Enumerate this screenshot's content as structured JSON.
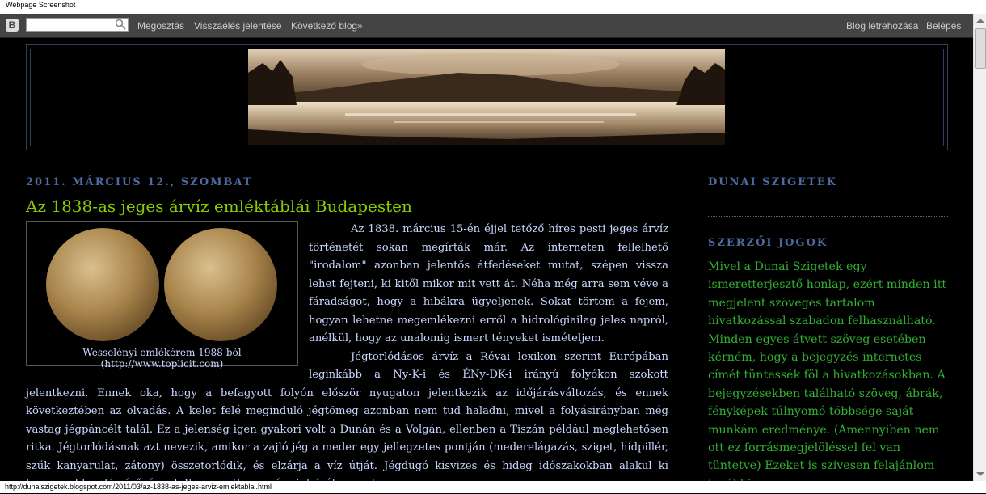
{
  "screenshot_label": "Webpage Screenshot",
  "navbar": {
    "search_placeholder": "",
    "links_left": [
      "Megosztás",
      "Visszaélés jelentése",
      "Következő blog»"
    ],
    "links_right": [
      "Blog létrehozása",
      "Belépés"
    ]
  },
  "post": {
    "date": "2011. március 12., szombat",
    "title": "Az 1838-as jeges árvíz emléktáblái Budapesten",
    "image_caption": "Wesselényi emlékérem 1988-ból (http://www.toplicit.com)",
    "paragraphs": [
      "Az 1838. március 15-én éjjel tetőző híres pesti jeges árvíz történetét sokan megírták már. Az interneten fellelhető \"irodalom\" azonban jelentős átfedéseket mutat, szépen vissza lehet fejteni, ki kitől mikor mit vett át. Néha még arra sem véve a fáradságot, hogy a hibákra ügyeljenek. Sokat törtem a fejem, hogyan lehetne megemlékezni erről a hidrológiailag jeles napról, anélkül, hogy az unalomig ismert tényeket ismételjem.",
      "Jégtorlódásos árvíz a Révai lexikon szerint Európában leginkább a Ny-K-i és ÉNy-DK-i irányú folyókon szokott jelentkezni. Ennek oka, hogy a befagyott folyón először nyugaton jelentkezik az időjárásváltozás, és ennek következtében az olvadás. A kelet felé meginduló jégtömeg azonban nem tud haladni, mivel a folyásirányban még vastag jégpáncélt talál. Ez a jelenség igen gyakori volt a Dunán és a Volgán, ellenben a Tiszán például meglehetősen ritka. Jégtorlódásnak azt nevezik, amikor a zajló jég a meder egy jellegzetes pontján (mederelágazás, sziget, hídpillér, szűk kanyarulat, zátony) összetorlódik, és elzárja a víz útját. Jégdugó kisvizes és hideg időszakokban alakul ki legnagyobb valószínűséggel. Ilyen esetben a vízszint órák, napok"
    ]
  },
  "sidebar": {
    "title1": "Dunai szigetek",
    "title2": "Szerzői jogok",
    "copyright_text": "Mivel a Dunai Szigetek egy ismeretterjesztő honlap, ezért minden itt megjelent szöveges tartalom hivatkozással szabadon felhasználható. Minden egyes átvett szöveg esetében kérném, hogy a bejegyzés internetes címét tüntessék föl a hivatkozásokban. A bejegyzésekben található szöveg, ábrák, fényképek túlnyomó többsége saját munkám eredménye. (Amennyiben nem ott ez forrásmegjelöléssel fel van tüntetve) Ezeket is szívesen felajánlom további"
  },
  "status_url": "http://dunaiszigetek.blogspot.com/2011/03/az-1838-as-jeges-arviz-emlektablai.html",
  "colors": {
    "date": "#4d6ba0",
    "title": "#88cc00",
    "body": "#c9d7ff",
    "sidebar_text": "#32b032"
  }
}
